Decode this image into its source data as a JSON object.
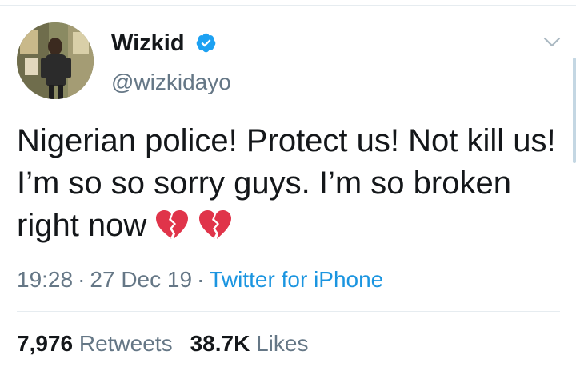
{
  "user": {
    "display_name": "Wizkid",
    "handle": "@wizkidayo",
    "verified": true
  },
  "tweet": {
    "text": "Nigerian police! Protect us! Not kill us! I’m so so sorry guys. I’m so broken right now",
    "emojis": [
      "broken-heart",
      "broken-heart"
    ]
  },
  "meta": {
    "time": "19:28",
    "separator": "·",
    "date": "27 Dec 19",
    "source": "Twitter for iPhone"
  },
  "stats": {
    "retweets_count": "7,976",
    "retweets_label": "Retweets",
    "likes_count": "38.7K",
    "likes_label": "Likes"
  },
  "colors": {
    "text": "#14171a",
    "secondary_text": "#657786",
    "link": "#1b95e0",
    "verified": "#1da1f2",
    "emoji_red": "#e0344a",
    "divider": "#e6ecf0"
  }
}
